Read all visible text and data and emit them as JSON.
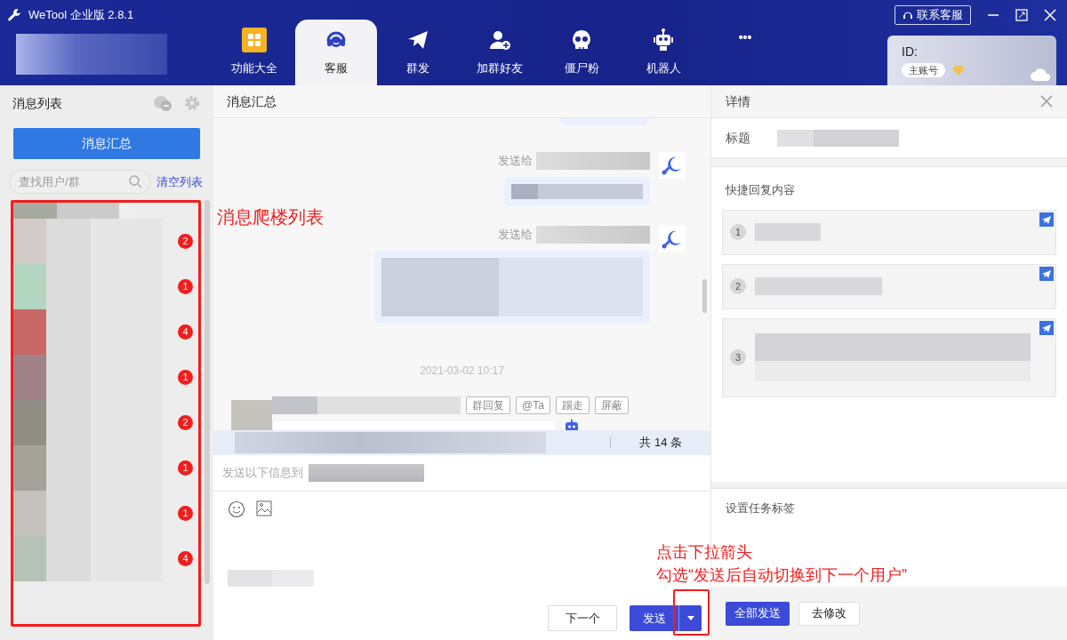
{
  "window": {
    "title": "WeTool 企业版 2.8.1"
  },
  "nav_tabs": [
    {
      "label": "功能大全",
      "selected": false
    },
    {
      "label": "客服",
      "selected": true
    },
    {
      "label": "群发",
      "selected": false
    },
    {
      "label": "加群好友",
      "selected": false
    },
    {
      "label": "僵尸粉",
      "selected": false
    },
    {
      "label": "机器人",
      "selected": false
    },
    {
      "label": "•••",
      "selected": false
    }
  ],
  "contact_button": "联系客服",
  "account": {
    "id_label": "ID:",
    "badge": "主账号"
  },
  "message_list": {
    "title": "消息列表",
    "summary_button": "消息汇总",
    "search_placeholder": "查找用户/群",
    "clear_link": "清空列表",
    "conversations": [
      {
        "unread": "2"
      },
      {
        "unread": "1"
      },
      {
        "unread": "4"
      },
      {
        "unread": "1"
      },
      {
        "unread": "2"
      },
      {
        "unread": "1"
      },
      {
        "unread": "1"
      },
      {
        "unread": "4"
      }
    ]
  },
  "annotations": {
    "list_note": "消息爬楼列表",
    "send_note": [
      "点击下拉箭头",
      "勾选“发送后自动切换到下一个用户”"
    ]
  },
  "chat": {
    "title": "消息汇总",
    "messages": [
      {
        "kind": "outgoing",
        "prefix": "发送给"
      },
      {
        "kind": "outgoing",
        "prefix": "发送给"
      },
      {
        "kind": "timestamp",
        "text": "2021-03-02 10:17"
      },
      {
        "kind": "incoming",
        "actions": [
          "群回复",
          "@Ta",
          "踢走",
          "屏蔽"
        ]
      }
    ],
    "total": "共 14 条"
  },
  "compose": {
    "label": "发送以下信息到",
    "next_button": "下一个",
    "send_button": "发送"
  },
  "details": {
    "title": "详情",
    "field_label": "标题",
    "quick_reply_title": "快捷回复内容",
    "quick_replies": [
      {
        "number": "1"
      },
      {
        "number": "2"
      },
      {
        "number": "3"
      }
    ],
    "tag_title": "设置任务标签",
    "send_all_button": "全部发送",
    "edit_button": "去修改"
  }
}
